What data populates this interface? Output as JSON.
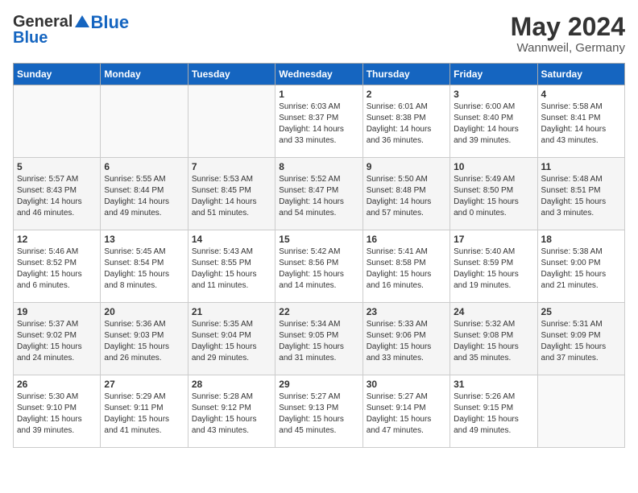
{
  "header": {
    "logo_general": "General",
    "logo_blue": "Blue",
    "month_year": "May 2024",
    "location": "Wannweil, Germany"
  },
  "days_of_week": [
    "Sunday",
    "Monday",
    "Tuesday",
    "Wednesday",
    "Thursday",
    "Friday",
    "Saturday"
  ],
  "weeks": [
    {
      "cells": [
        {
          "day": "",
          "content": ""
        },
        {
          "day": "",
          "content": ""
        },
        {
          "day": "",
          "content": ""
        },
        {
          "day": "1",
          "content": "Sunrise: 6:03 AM\nSunset: 8:37 PM\nDaylight: 14 hours\nand 33 minutes."
        },
        {
          "day": "2",
          "content": "Sunrise: 6:01 AM\nSunset: 8:38 PM\nDaylight: 14 hours\nand 36 minutes."
        },
        {
          "day": "3",
          "content": "Sunrise: 6:00 AM\nSunset: 8:40 PM\nDaylight: 14 hours\nand 39 minutes."
        },
        {
          "day": "4",
          "content": "Sunrise: 5:58 AM\nSunset: 8:41 PM\nDaylight: 14 hours\nand 43 minutes."
        }
      ]
    },
    {
      "cells": [
        {
          "day": "5",
          "content": "Sunrise: 5:57 AM\nSunset: 8:43 PM\nDaylight: 14 hours\nand 46 minutes."
        },
        {
          "day": "6",
          "content": "Sunrise: 5:55 AM\nSunset: 8:44 PM\nDaylight: 14 hours\nand 49 minutes."
        },
        {
          "day": "7",
          "content": "Sunrise: 5:53 AM\nSunset: 8:45 PM\nDaylight: 14 hours\nand 51 minutes."
        },
        {
          "day": "8",
          "content": "Sunrise: 5:52 AM\nSunset: 8:47 PM\nDaylight: 14 hours\nand 54 minutes."
        },
        {
          "day": "9",
          "content": "Sunrise: 5:50 AM\nSunset: 8:48 PM\nDaylight: 14 hours\nand 57 minutes."
        },
        {
          "day": "10",
          "content": "Sunrise: 5:49 AM\nSunset: 8:50 PM\nDaylight: 15 hours\nand 0 minutes."
        },
        {
          "day": "11",
          "content": "Sunrise: 5:48 AM\nSunset: 8:51 PM\nDaylight: 15 hours\nand 3 minutes."
        }
      ]
    },
    {
      "cells": [
        {
          "day": "12",
          "content": "Sunrise: 5:46 AM\nSunset: 8:52 PM\nDaylight: 15 hours\nand 6 minutes."
        },
        {
          "day": "13",
          "content": "Sunrise: 5:45 AM\nSunset: 8:54 PM\nDaylight: 15 hours\nand 8 minutes."
        },
        {
          "day": "14",
          "content": "Sunrise: 5:43 AM\nSunset: 8:55 PM\nDaylight: 15 hours\nand 11 minutes."
        },
        {
          "day": "15",
          "content": "Sunrise: 5:42 AM\nSunset: 8:56 PM\nDaylight: 15 hours\nand 14 minutes."
        },
        {
          "day": "16",
          "content": "Sunrise: 5:41 AM\nSunset: 8:58 PM\nDaylight: 15 hours\nand 16 minutes."
        },
        {
          "day": "17",
          "content": "Sunrise: 5:40 AM\nSunset: 8:59 PM\nDaylight: 15 hours\nand 19 minutes."
        },
        {
          "day": "18",
          "content": "Sunrise: 5:38 AM\nSunset: 9:00 PM\nDaylight: 15 hours\nand 21 minutes."
        }
      ]
    },
    {
      "cells": [
        {
          "day": "19",
          "content": "Sunrise: 5:37 AM\nSunset: 9:02 PM\nDaylight: 15 hours\nand 24 minutes."
        },
        {
          "day": "20",
          "content": "Sunrise: 5:36 AM\nSunset: 9:03 PM\nDaylight: 15 hours\nand 26 minutes."
        },
        {
          "day": "21",
          "content": "Sunrise: 5:35 AM\nSunset: 9:04 PM\nDaylight: 15 hours\nand 29 minutes."
        },
        {
          "day": "22",
          "content": "Sunrise: 5:34 AM\nSunset: 9:05 PM\nDaylight: 15 hours\nand 31 minutes."
        },
        {
          "day": "23",
          "content": "Sunrise: 5:33 AM\nSunset: 9:06 PM\nDaylight: 15 hours\nand 33 minutes."
        },
        {
          "day": "24",
          "content": "Sunrise: 5:32 AM\nSunset: 9:08 PM\nDaylight: 15 hours\nand 35 minutes."
        },
        {
          "day": "25",
          "content": "Sunrise: 5:31 AM\nSunset: 9:09 PM\nDaylight: 15 hours\nand 37 minutes."
        }
      ]
    },
    {
      "cells": [
        {
          "day": "26",
          "content": "Sunrise: 5:30 AM\nSunset: 9:10 PM\nDaylight: 15 hours\nand 39 minutes."
        },
        {
          "day": "27",
          "content": "Sunrise: 5:29 AM\nSunset: 9:11 PM\nDaylight: 15 hours\nand 41 minutes."
        },
        {
          "day": "28",
          "content": "Sunrise: 5:28 AM\nSunset: 9:12 PM\nDaylight: 15 hours\nand 43 minutes."
        },
        {
          "day": "29",
          "content": "Sunrise: 5:27 AM\nSunset: 9:13 PM\nDaylight: 15 hours\nand 45 minutes."
        },
        {
          "day": "30",
          "content": "Sunrise: 5:27 AM\nSunset: 9:14 PM\nDaylight: 15 hours\nand 47 minutes."
        },
        {
          "day": "31",
          "content": "Sunrise: 5:26 AM\nSunset: 9:15 PM\nDaylight: 15 hours\nand 49 minutes."
        },
        {
          "day": "",
          "content": ""
        }
      ]
    }
  ]
}
